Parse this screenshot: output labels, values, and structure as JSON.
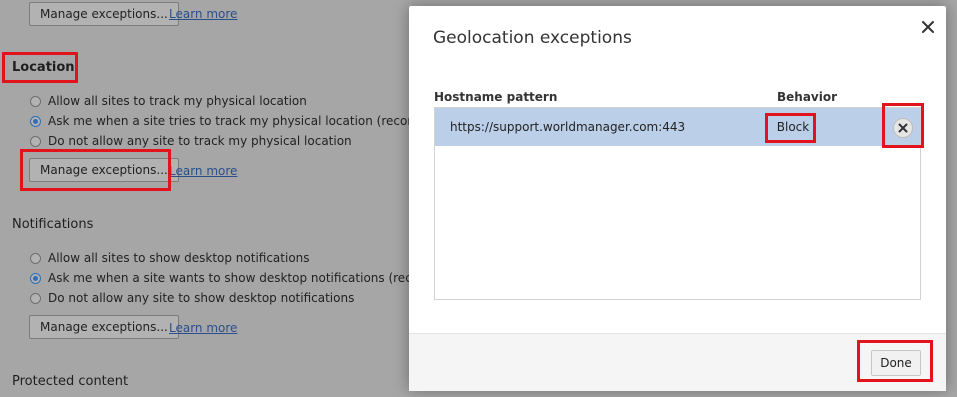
{
  "background": {
    "top_buttons": {
      "manage_label": "Manage exceptions...",
      "learn_more": "Learn more"
    },
    "location": {
      "title": "Location",
      "options": [
        {
          "label": "Allow all sites to track my physical location",
          "checked": false
        },
        {
          "label": "Ask me when a site tries to track my physical location (recommended)",
          "checked": true
        },
        {
          "label": "Do not allow any site to track my physical location",
          "checked": false
        }
      ],
      "manage_label": "Manage exceptions...",
      "learn_more": "Learn more"
    },
    "notifications": {
      "title": "Notifications",
      "options": [
        {
          "label": "Allow all sites to show desktop notifications",
          "checked": false
        },
        {
          "label": "Ask me when a site wants to show desktop notifications (recommended)",
          "checked": true
        },
        {
          "label": "Do not allow any site to show desktop notifications",
          "checked": false
        }
      ],
      "manage_label": "Manage exceptions...",
      "learn_more": "Learn more"
    },
    "protected_content": {
      "title": "Protected content"
    }
  },
  "dialog": {
    "title": "Geolocation exceptions",
    "columns": {
      "hostname": "Hostname pattern",
      "behavior": "Behavior"
    },
    "rows": [
      {
        "hostname": "https://support.worldmanager.com:443",
        "behavior": "Block"
      }
    ],
    "done_label": "Done"
  },
  "colors": {
    "highlight": "#e1141e",
    "selected_row": "#bccfe9",
    "link": "#2a4f8c"
  }
}
